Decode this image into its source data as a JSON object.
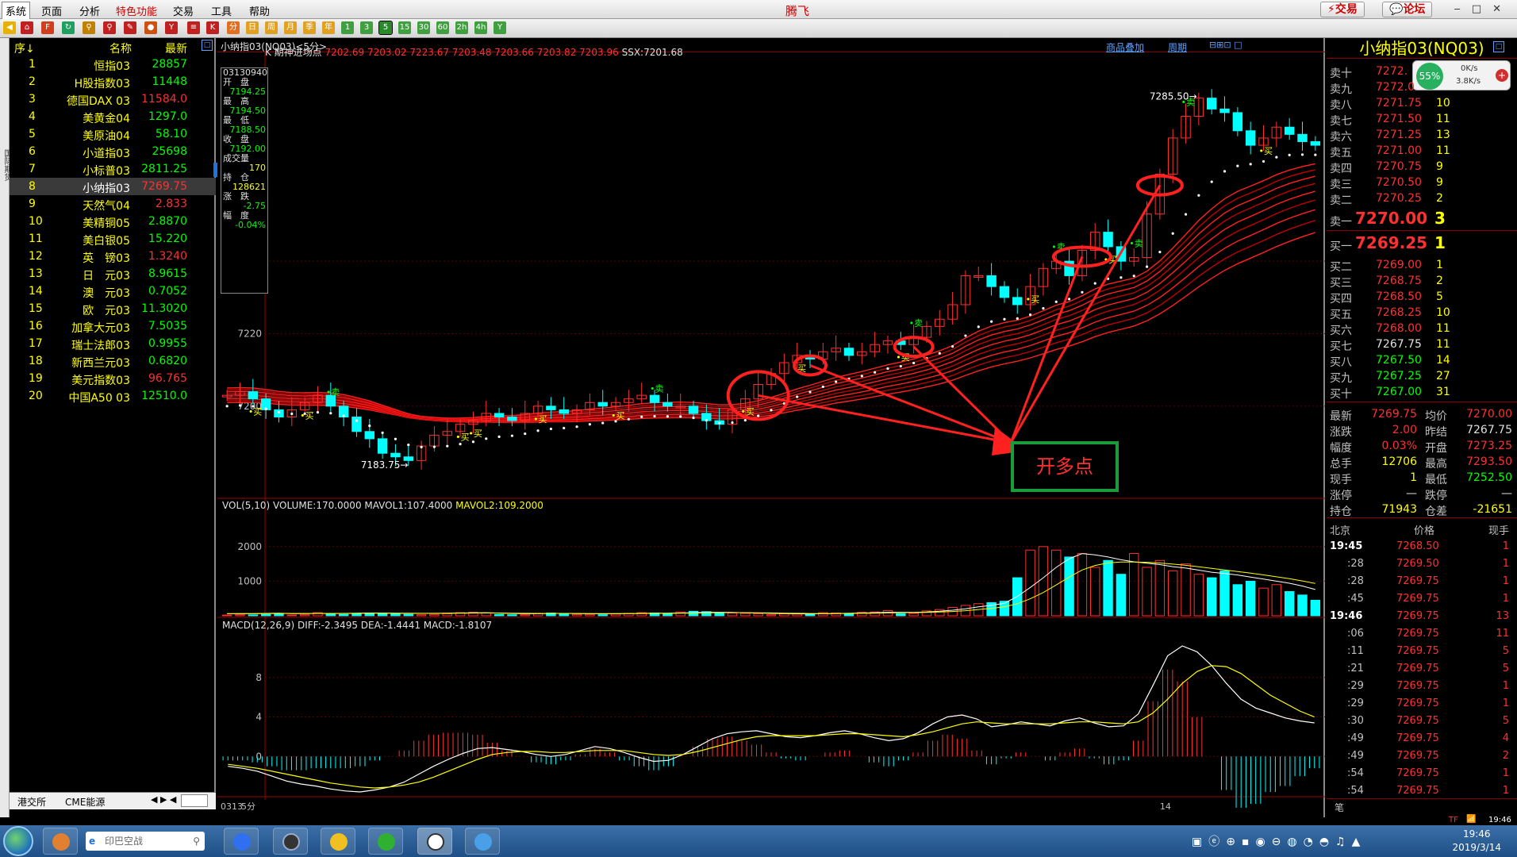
{
  "menu": {
    "items": [
      "系统",
      "页面",
      "分析",
      "特色功能",
      "交易",
      "工具",
      "帮助"
    ],
    "brand": "腾飞",
    "trade": "交易",
    "forum": "论坛"
  },
  "quotes": {
    "headers": {
      "seq": "序↓",
      "name": "名称",
      "last": "最新"
    },
    "rows": [
      {
        "n": "1",
        "name": "恒指03",
        "v": "28857",
        "c": "#00ff00"
      },
      {
        "n": "2",
        "name": "H股指数03",
        "v": "11448",
        "c": "#00ff00"
      },
      {
        "n": "3",
        "name": "德国DAX 03",
        "v": "11584.0",
        "c": "#ff3030"
      },
      {
        "n": "4",
        "name": "美黄金04",
        "v": "1297.0",
        "c": "#00ff00"
      },
      {
        "n": "5",
        "name": "美原油04",
        "v": "58.10",
        "c": "#00ff00"
      },
      {
        "n": "6",
        "name": "小道指03",
        "v": "25698",
        "c": "#00ff00"
      },
      {
        "n": "7",
        "name": "小标普03",
        "v": "2811.25",
        "c": "#00ff00"
      },
      {
        "n": "8",
        "name": "小纳指03",
        "v": "7269.75",
        "c": "#ff3030"
      },
      {
        "n": "9",
        "name": "天然气04",
        "v": "2.833",
        "c": "#ff3030"
      },
      {
        "n": "10",
        "name": "美精铜05",
        "v": "2.8870",
        "c": "#00ff00"
      },
      {
        "n": "11",
        "name": "美白银05",
        "v": "15.220",
        "c": "#00ff00"
      },
      {
        "n": "12",
        "name": "英　镑03",
        "v": "1.3240",
        "c": "#ff3030"
      },
      {
        "n": "13",
        "name": "日　元03",
        "v": "8.9615",
        "c": "#00ff00"
      },
      {
        "n": "14",
        "name": "澳　元03",
        "v": "0.7052",
        "c": "#00ff00"
      },
      {
        "n": "15",
        "name": "欧　元03",
        "v": "11.3020",
        "c": "#00ff00"
      },
      {
        "n": "16",
        "name": "加拿大元03",
        "v": "7.5035",
        "c": "#00ff00"
      },
      {
        "n": "17",
        "name": "瑞士法郎03",
        "v": "0.9955",
        "c": "#00ff00"
      },
      {
        "n": "18",
        "name": "新西兰元03",
        "v": "0.6820",
        "c": "#00ff00"
      },
      {
        "n": "19",
        "name": "美元指数03",
        "v": "96.765",
        "c": "#ff3030"
      },
      {
        "n": "20",
        "name": "中国A50 03",
        "v": "12510.0",
        "c": "#00ff00"
      }
    ],
    "selected": 7,
    "tabs": [
      "港交所",
      "CME能源"
    ]
  },
  "chart": {
    "title": "小纳指03(NQ03)<5分>",
    "links": [
      "商品叠加",
      "周期"
    ],
    "legend": "K 期神进场点",
    "legend_vals": "7202.69 7203.02 7223.67 7203.48 7203.66 7203.82 7203.96",
    "ssx": "SSX:7201.68",
    "vol_legend": "VOL(5,10) VOLUME:170.0000 MAVOL1:107.4000",
    "vol_mavol2": "MAVOL2:109.2000",
    "macd_legend": "MACD(12,26,9) DIFF:-2.3495 DEA:-1.4441 MACD:-1.8107",
    "period": "5分",
    "date_start": "0313",
    "date_mid": "14",
    "annot": "开多点",
    "hi_label": "7285.50",
    "lo_label": "7183.75",
    "buy": "买",
    "sell": "卖",
    "infobox": [
      {
        "l": "03130940"
      },
      {
        "l": "开　盘"
      },
      {
        "v": "7194.25",
        "c": "#00ff00"
      },
      {
        "l": "最　高"
      },
      {
        "v": "7194.50",
        "c": "#00ff00"
      },
      {
        "l": "最　低"
      },
      {
        "v": "7188.50",
        "c": "#00ff00"
      },
      {
        "l": "收　盘"
      },
      {
        "v": "7192.00",
        "c": "#00ff00"
      },
      {
        "l": "成交量"
      },
      {
        "v": "170",
        "c": "#ffff00"
      },
      {
        "l": "持　仓"
      },
      {
        "v": "128621",
        "c": "#ffff00"
      },
      {
        "l": "涨　跌"
      },
      {
        "v": "-2.75",
        "c": "#00ff00"
      },
      {
        "l": "幅　度"
      },
      {
        "v": "-0.04%",
        "c": "#00ff00"
      }
    ]
  },
  "chart_data": [
    {
      "type": "line",
      "panel": "price",
      "ylim": [
        7175,
        7295
      ],
      "yticks": [
        7200,
        7220,
        7240
      ],
      "close": [
        7203,
        7204,
        7202,
        7199,
        7197,
        7199,
        7201,
        7203,
        7200,
        7197,
        7193,
        7191,
        7187,
        7186,
        7185,
        7189,
        7192,
        7193,
        7195,
        7196,
        7198,
        7197,
        7196,
        7198,
        7200,
        7199,
        7198,
        7199,
        7201,
        7200,
        7201,
        7202,
        7203,
        7201,
        7200,
        7200,
        7198,
        7196,
        7195,
        7199,
        7202,
        7206,
        7209,
        7212,
        7214,
        7213,
        7215,
        7216,
        7214,
        7215,
        7217,
        7218,
        7217,
        7219,
        7222,
        7224,
        7228,
        7236,
        7236,
        7233,
        7230,
        7228,
        7233,
        7238,
        7240,
        7236,
        7243,
        7248,
        7244,
        7240,
        7241,
        7253,
        7264,
        7274,
        7280,
        7285,
        7282,
        7281,
        7276,
        7272,
        7274,
        7277,
        7275,
        7273,
        7272
      ]
    },
    {
      "type": "bar",
      "panel": "volume",
      "yticks": [
        1000,
        2000
      ],
      "ylim": [
        0,
        2800
      ],
      "values": [
        20,
        30,
        25,
        40,
        60,
        20,
        30,
        90,
        45,
        40,
        60,
        80,
        70,
        50,
        40,
        30,
        40,
        60,
        90,
        100,
        80,
        40,
        30,
        30,
        60,
        80,
        50,
        40,
        40,
        30,
        50,
        70,
        90,
        80,
        60,
        110,
        130,
        120,
        90,
        80,
        70,
        60,
        30,
        60,
        50,
        50,
        90,
        80,
        70,
        100,
        110,
        150,
        60,
        70,
        140,
        180,
        240,
        300,
        350,
        380,
        420,
        1100,
        1900,
        2000,
        1900,
        1700,
        1800,
        1400,
        1600,
        1200,
        1800,
        1400,
        1600,
        1300,
        1500,
        1200,
        1100,
        1300,
        900,
        1000,
        800,
        900,
        700,
        600,
        450
      ],
      "ma": [
        60,
        62,
        61,
        70,
        75,
        65,
        64,
        68,
        66,
        70,
        75,
        80,
        78,
        72,
        70,
        68,
        70,
        74,
        80,
        88,
        90,
        78,
        66,
        60,
        60,
        66,
        70,
        64,
        60,
        58,
        60,
        64,
        70,
        75,
        74,
        80,
        90,
        100,
        102,
        96,
        88,
        80,
        70,
        64,
        58,
        56,
        60,
        66,
        72,
        80,
        90,
        100,
        100,
        98,
        110,
        130,
        160,
        200,
        260,
        300,
        360,
        560,
        820,
        1100,
        1400,
        1650,
        1800,
        1760,
        1700,
        1620,
        1560,
        1520,
        1480,
        1420,
        1380,
        1320,
        1260,
        1220,
        1180,
        1120,
        1060,
        1000,
        940,
        860,
        760
      ]
    },
    {
      "type": "bar",
      "panel": "macd",
      "ylim": [
        -4,
        12
      ],
      "yticks": [
        0,
        4,
        8
      ],
      "diff": [
        -1,
        -1.2,
        -1.5,
        -2,
        -2.5,
        -2.8,
        -3,
        -3.3,
        -3.5,
        -3.6,
        -3.4,
        -3.1,
        -2.6,
        -1.8,
        -1,
        -0.3,
        0.3,
        0.8,
        0.9,
        0.7,
        0.5,
        0.2,
        0,
        0.2,
        0.6,
        1,
        0.8,
        0.4,
        -0.1,
        -0.5,
        -0.4,
        0.2,
        1,
        1.8,
        2.3,
        2.5,
        2.6,
        2.3,
        2,
        1.9,
        2.1,
        2.4,
        2.6,
        2.3,
        1.9,
        1.6,
        1.8,
        2.4,
        3.3,
        4,
        4.2,
        3.8,
        3,
        3.2,
        3.5,
        3.3,
        3.1,
        3.6,
        3.9,
        3.4,
        3,
        3.1,
        4.3,
        7.2,
        10.2,
        11.2,
        10.6,
        9.2,
        7.4,
        5.8,
        4.9,
        4.4,
        3.9,
        3.6,
        3.4
      ],
      "dea": [
        -0.8,
        -1,
        -1.2,
        -1.5,
        -1.8,
        -2.1,
        -2.4,
        -2.7,
        -2.9,
        -3.1,
        -3.2,
        -3.1,
        -2.9,
        -2.6,
        -2.1,
        -1.5,
        -0.9,
        -0.3,
        0.2,
        0.4,
        0.5,
        0.5,
        0.4,
        0.4,
        0.5,
        0.6,
        0.6,
        0.6,
        0.4,
        0.2,
        0.1,
        0.2,
        0.5,
        0.9,
        1.3,
        1.7,
        2,
        2.1,
        2.1,
        2.1,
        2.1,
        2.2,
        2.3,
        2.3,
        2.2,
        2.1,
        2,
        2.2,
        2.5,
        2.9,
        3.3,
        3.5,
        3.4,
        3.3,
        3.3,
        3.3,
        3.3,
        3.4,
        3.5,
        3.5,
        3.4,
        3.3,
        3.5,
        4.4,
        5.8,
        7.4,
        8.6,
        9.2,
        9.1,
        8.4,
        7.3,
        6.2,
        5.4,
        4.6,
        4
      ]
    }
  ],
  "orderbook": {
    "title": "小纳指03(NQ03)",
    "asks": [
      {
        "l": "卖十",
        "p": "7272.",
        "v": ""
      },
      {
        "l": "卖九",
        "p": "7272.0",
        "v": ""
      },
      {
        "l": "卖八",
        "p": "7271.75",
        "v": "10"
      },
      {
        "l": "卖七",
        "p": "7271.50",
        "v": "11"
      },
      {
        "l": "卖六",
        "p": "7271.25",
        "v": "13"
      },
      {
        "l": "卖五",
        "p": "7271.00",
        "v": "11"
      },
      {
        "l": "卖四",
        "p": "7270.75",
        "v": "9"
      },
      {
        "l": "卖三",
        "p": "7270.50",
        "v": "9"
      },
      {
        "l": "卖二",
        "p": "7270.25",
        "v": "2"
      }
    ],
    "ask1": {
      "l": "卖一",
      "p": "7270.00",
      "v": "3"
    },
    "bid1": {
      "l": "买一",
      "p": "7269.25",
      "v": "1"
    },
    "bids": [
      {
        "l": "买二",
        "p": "7269.00",
        "v": "1"
      },
      {
        "l": "买三",
        "p": "7268.75",
        "v": "2"
      },
      {
        "l": "买四",
        "p": "7268.50",
        "v": "5"
      },
      {
        "l": "买五",
        "p": "7268.25",
        "v": "10"
      },
      {
        "l": "买六",
        "p": "7268.00",
        "v": "11"
      },
      {
        "l": "买七",
        "p": "7267.75",
        "v": "11"
      },
      {
        "l": "买八",
        "p": "7267.50",
        "v": "14"
      },
      {
        "l": "买九",
        "p": "7267.25",
        "v": "27"
      },
      {
        "l": "买十",
        "p": "7267.00",
        "v": "31"
      }
    ],
    "widget": {
      "pct": "55%",
      "up": "0K/s",
      "down": "3.8K/s"
    }
  },
  "stats": [
    [
      {
        "l": "最新",
        "v": "7269.75",
        "c": "#ff3030"
      },
      {
        "l": "均价",
        "v": "7270.00",
        "c": "#ff3030"
      }
    ],
    [
      {
        "l": "涨跌",
        "v": "2.00",
        "c": "#ff3030"
      },
      {
        "l": "昨结",
        "v": "7267.75",
        "c": "#e0e0e0"
      }
    ],
    [
      {
        "l": "幅度",
        "v": "0.03%",
        "c": "#ff3030"
      },
      {
        "l": "开盘",
        "v": "7273.25",
        "c": "#ff3030"
      }
    ],
    [
      {
        "l": "总手",
        "v": "12706",
        "c": "#ffff00"
      },
      {
        "l": "最高",
        "v": "7293.50",
        "c": "#ff3030"
      }
    ],
    [
      {
        "l": "现手",
        "v": "1",
        "c": "#ffff00"
      },
      {
        "l": "最低",
        "v": "7252.50",
        "c": "#00ff00"
      }
    ],
    [
      {
        "l": "涨停",
        "v": "—",
        "c": "#e0e0e0"
      },
      {
        "l": "跌停",
        "v": "—",
        "c": "#e0e0e0"
      }
    ],
    [
      {
        "l": "持仓",
        "v": "71943",
        "c": "#ffff00"
      },
      {
        "l": "仓差",
        "v": "-21651",
        "c": "#ffff00"
      }
    ]
  ],
  "ticks": {
    "headers": {
      "city": "北京",
      "price": "价格",
      "vol": "现手"
    },
    "rows": [
      {
        "t": "19:45",
        "p": "7268.50",
        "v": "1",
        "b": true
      },
      {
        "t": ":28",
        "p": "7269.50",
        "v": "1"
      },
      {
        "t": ":28",
        "p": "7269.75",
        "v": "1"
      },
      {
        "t": ":45",
        "p": "7269.75",
        "v": "1"
      },
      {
        "t": "19:46",
        "p": "7269.75",
        "v": "13",
        "b": true
      },
      {
        "t": ":06",
        "p": "7269.75",
        "v": "11"
      },
      {
        "t": ":11",
        "p": "7269.75",
        "v": "5"
      },
      {
        "t": ":21",
        "p": "7269.75",
        "v": "5"
      },
      {
        "t": ":29",
        "p": "7269.75",
        "v": "1"
      },
      {
        "t": ":29",
        "p": "7269.75",
        "v": "1"
      },
      {
        "t": ":30",
        "p": "7269.75",
        "v": "5"
      },
      {
        "t": ":49",
        "p": "7269.75",
        "v": "4"
      },
      {
        "t": ":49",
        "p": "7269.75",
        "v": "2"
      },
      {
        "t": ":54",
        "p": "7269.75",
        "v": "1"
      },
      {
        "t": ":54",
        "p": "7269.75",
        "v": "1"
      }
    ],
    "footer": "笔"
  },
  "taskbar": {
    "search": "印巴空战",
    "time": "19:46",
    "date": "2019/3/14",
    "status_time": "19:46"
  }
}
